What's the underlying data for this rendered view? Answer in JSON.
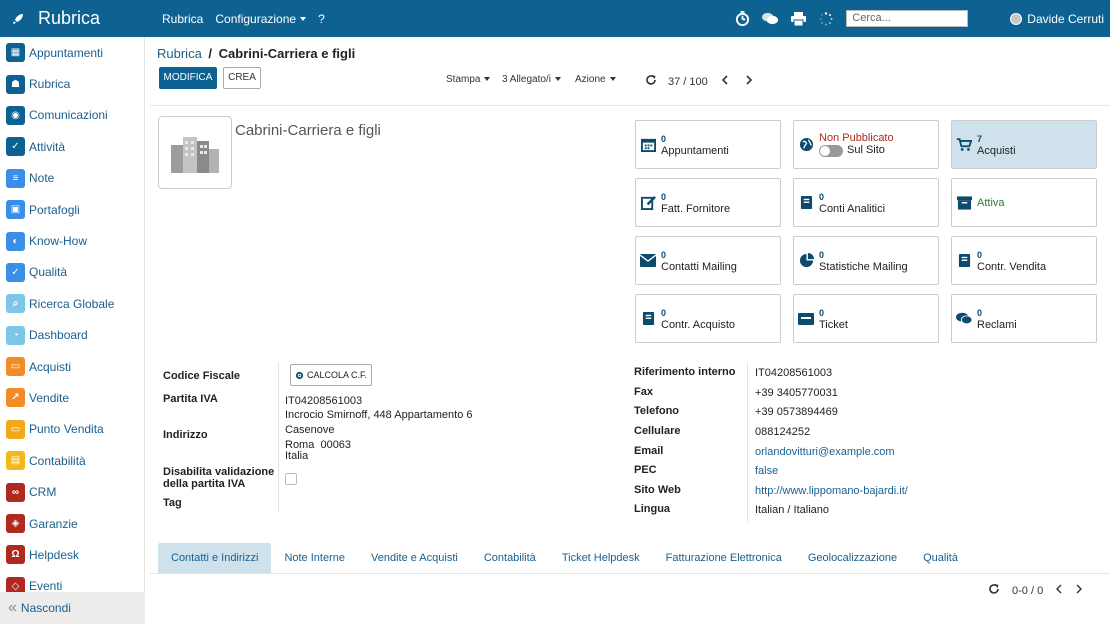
{
  "app": {
    "title": "Rubrica"
  },
  "topnav": {
    "items": [
      "Rubrica",
      "Configurazione",
      "?"
    ]
  },
  "search": {
    "placeholder": "Cerca..."
  },
  "user": {
    "name": "Davide Cerruti"
  },
  "sidebar": {
    "items": [
      {
        "label": "Appuntamenti",
        "color": "#0d6292",
        "icon": "calendar-icon"
      },
      {
        "label": "Rubrica",
        "color": "#0d6292",
        "icon": "contacts-icon"
      },
      {
        "label": "Comunicazioni",
        "color": "#0d6292",
        "icon": "chat-icon"
      },
      {
        "label": "Attività",
        "color": "#0d6292",
        "icon": "check-icon"
      },
      {
        "label": "Note",
        "color": "#3a8ee6",
        "icon": "note-icon"
      },
      {
        "label": "Portafogli",
        "color": "#3a8ee6",
        "icon": "lock-icon"
      },
      {
        "label": "Know-How",
        "color": "#3a8ee6",
        "icon": "head-icon"
      },
      {
        "label": "Qualità",
        "color": "#3a8ee6",
        "icon": "quality-icon"
      },
      {
        "label": "Ricerca Globale",
        "color": "#7cc6e8",
        "icon": "search-icon"
      },
      {
        "label": "Dashboard",
        "color": "#7cc6e8",
        "icon": "dashboard-icon"
      },
      {
        "label": "Acquisti",
        "color": "#f28c28",
        "icon": "cart-icon"
      },
      {
        "label": "Vendite",
        "color": "#f28c28",
        "icon": "chart-icon"
      },
      {
        "label": "Punto Vendita",
        "color": "#f2a81c",
        "icon": "pos-icon"
      },
      {
        "label": "Contabilità",
        "color": "#f2b81c",
        "icon": "calculator-icon"
      },
      {
        "label": "CRM",
        "color": "#b0281e",
        "icon": "handshake-icon"
      },
      {
        "label": "Garanzie",
        "color": "#b0281e",
        "icon": "shield-icon"
      },
      {
        "label": "Helpdesk",
        "color": "#b0281e",
        "icon": "headset-icon"
      },
      {
        "label": "Eventi",
        "color": "#b0281e",
        "icon": "ticket-icon"
      }
    ],
    "hide_label": "Nascondi"
  },
  "breadcrumb": {
    "parent": "Rubrica",
    "separator": "/",
    "current": "Cabrini-Carriera e figli"
  },
  "toolbar": {
    "edit_label": "MODIFICA",
    "create_label": "CREA",
    "print_label": "Stampa",
    "attachments_label": "3 Allegato/i",
    "action_label": "Azione",
    "pager": "37 / 100"
  },
  "record": {
    "name": "Cabrini-Carriera e figli"
  },
  "smart_buttons": [
    {
      "count": "0",
      "label": "Appuntamenti",
      "icon": "calendar-icon"
    },
    {
      "status": "Non Pubblicato",
      "label": "Sul Sito",
      "icon": "globe-icon"
    },
    {
      "count": "7",
      "label": "Acquisti",
      "icon": "cart-icon"
    },
    {
      "count": "0",
      "label": "Fatt. Fornitore",
      "icon": "edit-icon"
    },
    {
      "count": "0",
      "label": "Conti Analitici",
      "icon": "book-icon"
    },
    {
      "label": "Attiva",
      "icon": "archive-icon"
    },
    {
      "count": "0",
      "label": "Contatti Mailing",
      "icon": "envelope-icon"
    },
    {
      "count": "0",
      "label": "Statistiche Mailing",
      "icon": "pie-icon"
    },
    {
      "count": "0",
      "label": "Contr. Vendita",
      "icon": "book-icon"
    },
    {
      "count": "0",
      "label": "Contr. Acquisto",
      "icon": "book-icon"
    },
    {
      "count": "0",
      "label": "Ticket",
      "icon": "ticket-icon"
    },
    {
      "count": "0",
      "label": "Reclami",
      "icon": "comments-icon"
    }
  ],
  "left_fields": {
    "codice_fiscale": {
      "label": "Codice Fiscale",
      "button": "CALCOLA C.F."
    },
    "partita_iva": {
      "label": "Partita IVA",
      "value": "IT04208561003"
    },
    "indirizzo": {
      "label": "Indirizzo",
      "street": "Incrocio Smirnoff, 448 Appartamento 6",
      "city": "Casenove",
      "zip_line": "Roma  00063",
      "country": "Italia"
    },
    "disabilita": {
      "label_line1": "Disabilita validazione",
      "label_line2": "della partita IVA"
    },
    "tag": {
      "label": "Tag"
    }
  },
  "right_fields": [
    {
      "label": "Riferimento interno",
      "value": "IT04208561003",
      "link": false
    },
    {
      "label": "Fax",
      "value": "+39 3405770031",
      "link": false
    },
    {
      "label": "Telefono",
      "value": "+39 0573894469",
      "link": false
    },
    {
      "label": "Cellulare",
      "value": "088124252",
      "link": false
    },
    {
      "label": "Email",
      "value": "orlandovitturi@example.com",
      "link": true
    },
    {
      "label": "PEC",
      "value": "false",
      "link": true
    },
    {
      "label": "Sito Web",
      "value": "http://www.lippomano-bajardi.it/",
      "link": true
    },
    {
      "label": "Lingua",
      "value": "Italian / Italiano",
      "link": false
    }
  ],
  "tabs": [
    "Contatti e Indirizzi",
    "Note Interne",
    "Vendite e Acquisti",
    "Contabilità",
    "Ticket Helpdesk",
    "Fatturazione Elettronica",
    "Geolocalizzazione",
    "Qualità"
  ],
  "subpager": {
    "value": "0-0 / 0"
  }
}
